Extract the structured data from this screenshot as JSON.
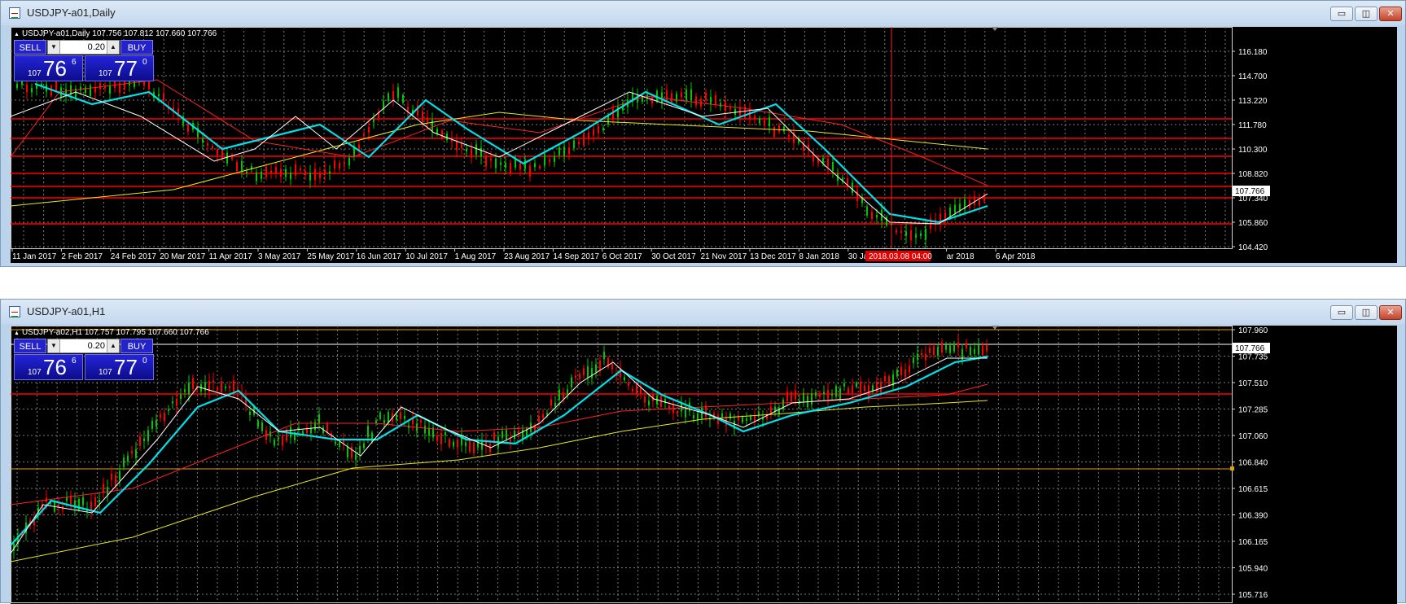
{
  "windows": [
    {
      "title": "USDJPY-a01,Daily",
      "info": "USDJPY-a01,Daily  107.756 107.812 107.660 107.766",
      "trade": {
        "sell": "SELL",
        "buy": "BUY",
        "lot": "0.20",
        "bid_prefix": "107",
        "bid_big": "76",
        "bid_sup": "6",
        "ask_prefix": "107",
        "ask_big": "77",
        "ask_sup": "0"
      },
      "yticks": [
        "116.180",
        "114.700",
        "113.220",
        "111.780",
        "110.300",
        "108.820",
        "107.340",
        "105.860",
        "104.420"
      ],
      "price_label": "107.766",
      "xticks": [
        "11 Jan 2017",
        "2 Feb 2017",
        "24 Feb 2017",
        "20 Mar 2017",
        "11 Apr 2017",
        "3 May 2017",
        "25 May 2017",
        "16 Jun 2017",
        "10 Jul 2017",
        "1 Aug 2017",
        "23 Aug 2017",
        "14 Sep 2017",
        "6 Oct 2017",
        "30 Oct 2017",
        "21 Nov 2017",
        "13 Dec 2017",
        "8 Jan 2018",
        "30 Jan 2018",
        "2",
        "ar 2018",
        "6 Apr 2018"
      ],
      "cursor_label": "2018.03.08 04:00",
      "colors": {
        "bull": "#00c800",
        "bear": "#ff0000",
        "hline": "#ff0000",
        "ma_fast": "#ffffff",
        "ma_mid": "#00e0e8",
        "ma_slow": "#ff2020",
        "ma_long": "#e8e820"
      }
    },
    {
      "title": "USDJPY-a01,H1",
      "info": "USDJPY-a02,H1  107.757 107.795 107.660 107.766",
      "trade": {
        "sell": "SELL",
        "buy": "BUY",
        "lot": "0.20",
        "bid_prefix": "107",
        "bid_big": "76",
        "bid_sup": "6",
        "ask_prefix": "107",
        "ask_big": "77",
        "ask_sup": "0"
      },
      "yticks": [
        "107.960",
        "107.735",
        "107.510",
        "107.285",
        "107.060",
        "106.840",
        "106.615",
        "106.390",
        "106.165",
        "105.940",
        "105.716"
      ],
      "price_label": "107.766",
      "colors": {
        "bull": "#00c800",
        "bear": "#ff0000",
        "hline": "#ff0000",
        "orange_line": "#e0a000",
        "ma_fast": "#ffffff",
        "ma_mid": "#00e0e8",
        "ma_slow": "#ff2020",
        "ma_long": "#e8e820"
      }
    }
  ],
  "window_buttons": {
    "minimize": "▭",
    "restore": "◫",
    "close": "✕"
  }
}
